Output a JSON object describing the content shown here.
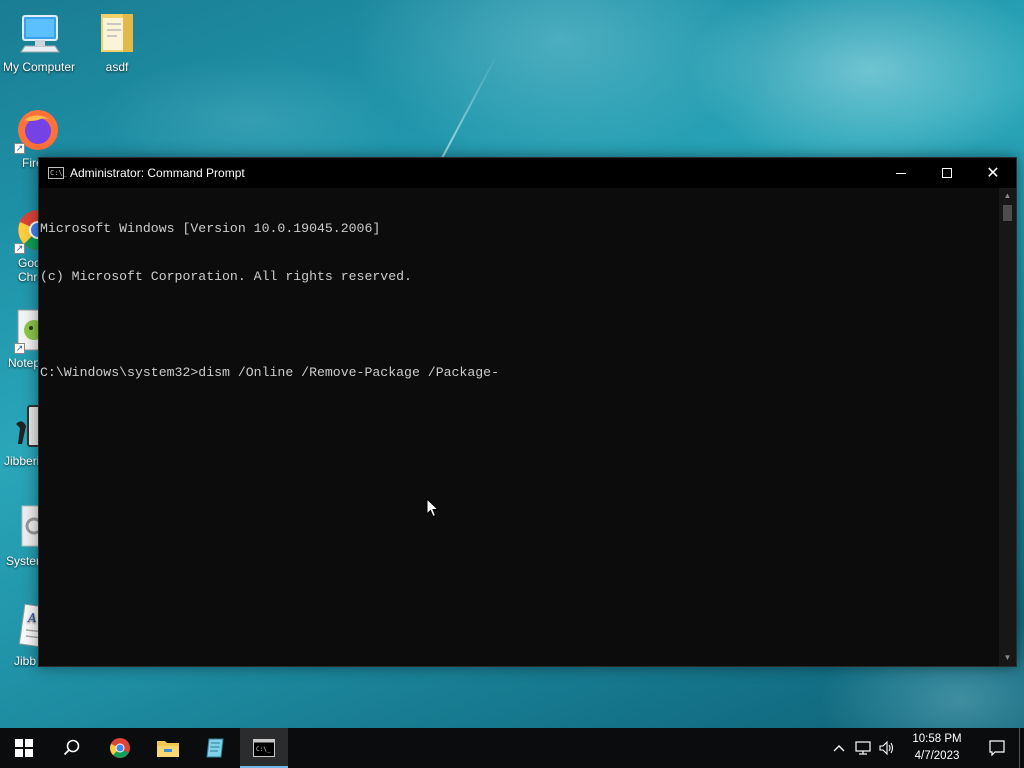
{
  "desktop": {
    "icons": [
      {
        "label": "My Computer",
        "icon": "computer-icon"
      },
      {
        "label": "asdf",
        "icon": "folder-icon"
      },
      {
        "label": "Fire",
        "icon": "firefox-icon"
      },
      {
        "label": "Goo\nChro",
        "icon": "chrome-icon"
      },
      {
        "label": "Notep",
        "icon": "notepad-plus-icon"
      },
      {
        "label": "Jibberi",
        "icon": "jibberish-tool-icon"
      },
      {
        "label": "Syster",
        "icon": "system-settings-icon"
      },
      {
        "label": "Jibb",
        "icon": "jibberish-doc-icon"
      }
    ]
  },
  "cmd_window": {
    "title": "Administrator: Command Prompt",
    "app_icon_text": "C:\\_",
    "lines": [
      "Microsoft Windows [Version 10.0.19045.2006]",
      "(c) Microsoft Corporation. All rights reserved.",
      "",
      "C:\\Windows\\system32>dism /Online /Remove-Package /Package-"
    ]
  },
  "taskbar": {
    "items": [
      {
        "name": "start-button",
        "icon": "windows-logo-icon"
      },
      {
        "name": "search-button",
        "icon": "search-icon"
      },
      {
        "name": "taskbar-chrome",
        "icon": "chrome-icon"
      },
      {
        "name": "taskbar-file-explorer",
        "icon": "folder-icon"
      },
      {
        "name": "taskbar-notepad",
        "icon": "notepad-icon"
      },
      {
        "name": "taskbar-cmd",
        "icon": "cmd-icon",
        "active": true
      }
    ],
    "tray": {
      "time": "10:58 PM",
      "date": "4/7/2023"
    }
  },
  "colors": {
    "console_bg": "#0c0c0c",
    "console_text": "#cccccc",
    "taskbar_bg": "#0a0c0d",
    "accent": "#76b9ed"
  }
}
